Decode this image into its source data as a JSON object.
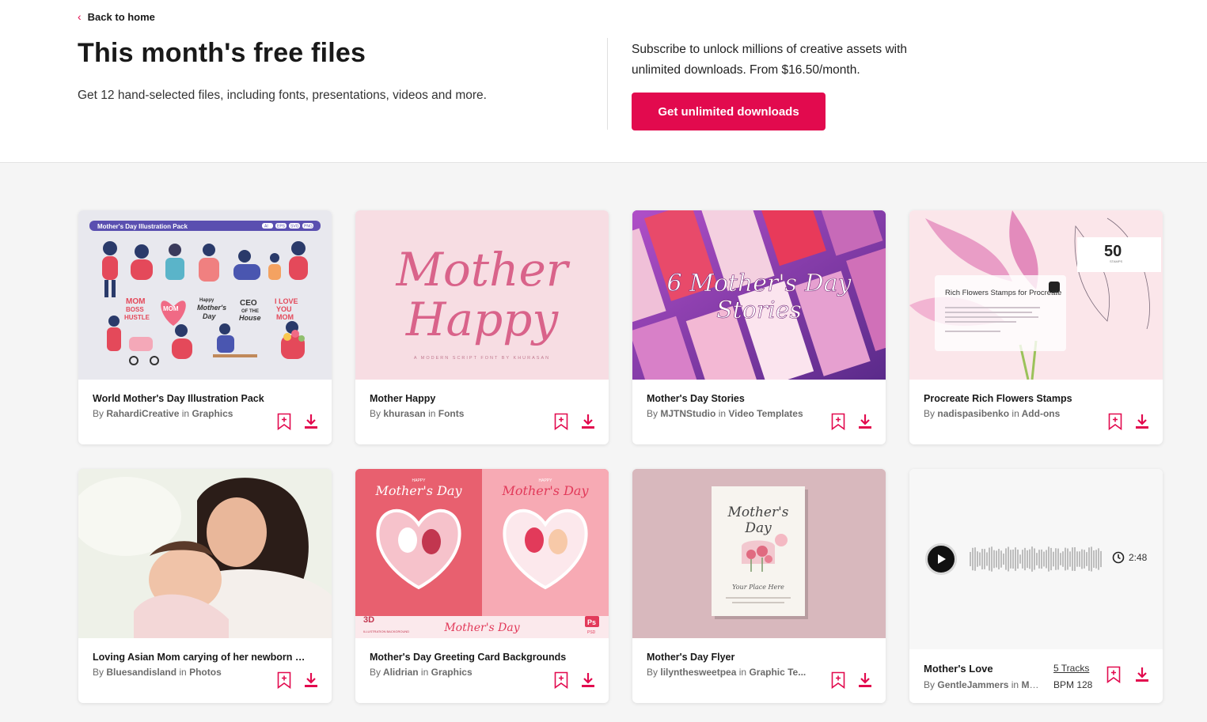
{
  "header": {
    "back_label": "Back to home",
    "title": "This month's free files",
    "subtitle": "Get 12 hand-selected files, including fonts, presentations, videos and more.",
    "promo_text": "Subscribe to unlock millions of creative assets with unlimited downloads. From $16.50/month.",
    "cta_label": "Get unlimited downloads"
  },
  "colors": {
    "accent": "#e20a4e",
    "page_bg": "#f5f5f5",
    "text": "#191919",
    "muted": "#6b6b6b"
  },
  "icons": [
    "chevron-left-icon",
    "bookmark-add-icon",
    "download-icon",
    "play-icon",
    "clock-icon"
  ],
  "cards": [
    {
      "title": "World Mother's Day Illustration Pack",
      "author": "RahardiCreative",
      "in": "in",
      "category": "Graphics",
      "by": "By",
      "thumb": {
        "banner": "Mother's Day Illustration Pack",
        "formats": [
          "AI",
          "EPS",
          "SVG",
          "PNG"
        ],
        "stickers": [
          "MOM BOSS HUSTLE",
          "MOM derful",
          "Happy Mother's Day",
          "CEO OF THE House",
          "I LOVE YOU MOM"
        ]
      }
    },
    {
      "title": "Mother Happy",
      "author": "khurasan",
      "in": "in",
      "category": "Fonts",
      "by": "By",
      "thumb": {
        "line1": "Mother",
        "line2": "Happy",
        "tagline": "A MODERN SCRIPT FONT BY KHURASAN"
      }
    },
    {
      "title": "Mother's Day Stories",
      "author": "MJTNStudio",
      "in": "in",
      "category": "Video Templates",
      "by": "By",
      "thumb": {
        "line1": "6 Mother's Day",
        "line2": "Stories"
      }
    },
    {
      "title": "Procreate Rich Flowers Stamps",
      "author": "nadispasibenko",
      "in": "in",
      "category": "Add-ons",
      "by": "By",
      "thumb": {
        "count": "50",
        "count_label": "STAMPS",
        "panel_title": "Rich Flowers Stamps for Procreate"
      }
    },
    {
      "title": "Loving Asian Mom carying of her newborn ba...",
      "author": "Bluesandisland",
      "in": "in",
      "category": "Photos",
      "by": "By",
      "thumb": {}
    },
    {
      "title": "Mother's Day Greeting Card Backgrounds",
      "author": "Alidrian",
      "in": "in",
      "category": "Graphics",
      "by": "By",
      "thumb": {
        "small_top": "HAPPY",
        "script": "Mother's Day",
        "footer_script": "Mother's Day",
        "badge_3d": "3D",
        "badge_3d_sub": "ILLUSTRATION BACKGROUND",
        "ps": "Ps",
        "ps_sub": "PSD"
      }
    },
    {
      "title": "Mother's Day Flyer",
      "author": "lilynthesweetpea",
      "in": "in",
      "category": "Graphic Te...",
      "by": "By",
      "thumb": {
        "script1": "Mother's",
        "script2": "Day",
        "place": "Your Place Here"
      }
    }
  ],
  "music": {
    "title": "Mother's Love",
    "by": "By",
    "author": "GentleJammers",
    "in": "in",
    "category": "Mu...",
    "tracks": "5 Tracks",
    "bpm": "BPM 128",
    "duration": "2:48"
  }
}
